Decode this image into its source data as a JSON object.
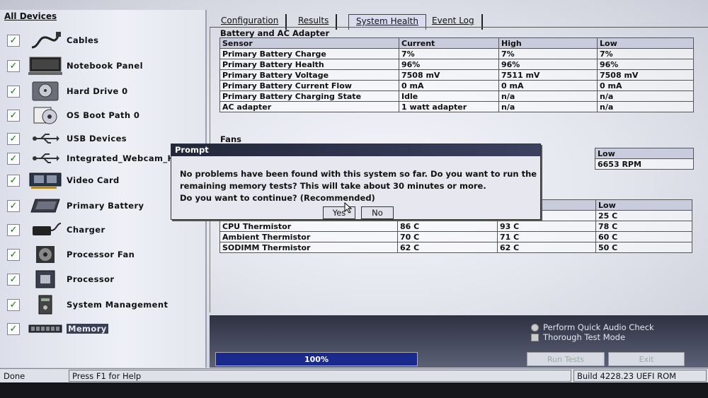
{
  "left_panel": {
    "title": "All Devices",
    "devices": [
      {
        "label": "Cables",
        "icon": "cable-icon"
      },
      {
        "label": "Notebook Panel",
        "icon": "notebook-panel-icon"
      },
      {
        "label": "Hard Drive 0",
        "icon": "hard-drive-icon"
      },
      {
        "label": "OS Boot Path 0",
        "icon": "boot-path-icon"
      },
      {
        "label": "USB Devices",
        "icon": "usb-icon"
      },
      {
        "label": "Integrated_Webcam_H",
        "icon": "usb-icon"
      },
      {
        "label": "Video Card",
        "icon": "video-card-icon"
      },
      {
        "label": "Primary Battery",
        "icon": "battery-icon"
      },
      {
        "label": "Charger",
        "icon": "charger-icon"
      },
      {
        "label": "Processor Fan",
        "icon": "fan-icon"
      },
      {
        "label": "Processor",
        "icon": "processor-icon"
      },
      {
        "label": "System Management",
        "icon": "system-management-icon"
      },
      {
        "label": "Memory",
        "icon": "memory-icon"
      }
    ]
  },
  "tabs": [
    "Configuration",
    "Results",
    "System Health",
    "Event Log"
  ],
  "battery": {
    "section_title": "Battery and AC Adapter",
    "columns": [
      "Sensor",
      "Current",
      "High",
      "Low"
    ],
    "rows": [
      [
        "Primary Battery Charge",
        "7%",
        "7%",
        "7%"
      ],
      [
        "Primary Battery Health",
        "96%",
        "96%",
        "96%"
      ],
      [
        "Primary Battery Voltage",
        "7508 mV",
        "7511 mV",
        "7508 mV"
      ],
      [
        "Primary Battery Current Flow",
        "0 mA",
        "0 mA",
        "0 mA"
      ],
      [
        "Primary Battery Charging State",
        "Idle",
        "n/a",
        "n/a"
      ],
      [
        "AC adapter",
        "1 watt adapter",
        "n/a",
        "n/a"
      ]
    ]
  },
  "fans": {
    "section_title": "Fans",
    "low_header": "Low",
    "low_value": "6653 RPM"
  },
  "thermal": {
    "low_header": "Low",
    "first_low": "25 C",
    "rows": [
      [
        "CPU Thermistor",
        "86 C",
        "93 C",
        "78 C"
      ],
      [
        "Ambient Thermistor",
        "70 C",
        "71 C",
        "60 C"
      ],
      [
        "SODIMM Thermistor",
        "62 C",
        "62 C",
        "50 C"
      ]
    ]
  },
  "dialog": {
    "title": "Prompt",
    "line1": "No problems have been found with this system so far. Do you want to run the",
    "line2": "remaining memory tests?  This will take about 30 minutes or more.",
    "line3": "Do you want to continue? (Recommended)",
    "yes": "Yes",
    "no": "No"
  },
  "bottom": {
    "audio_check": "Perform Quick Audio Check",
    "thorough": "Thorough Test Mode",
    "progress_text": "100%",
    "progress": 1.0,
    "run_tests": "Run Tests",
    "exit": "Exit"
  },
  "status": {
    "left": "Done",
    "help": "Press F1 for Help",
    "build": "Build  4228.23 UEFI ROM"
  }
}
